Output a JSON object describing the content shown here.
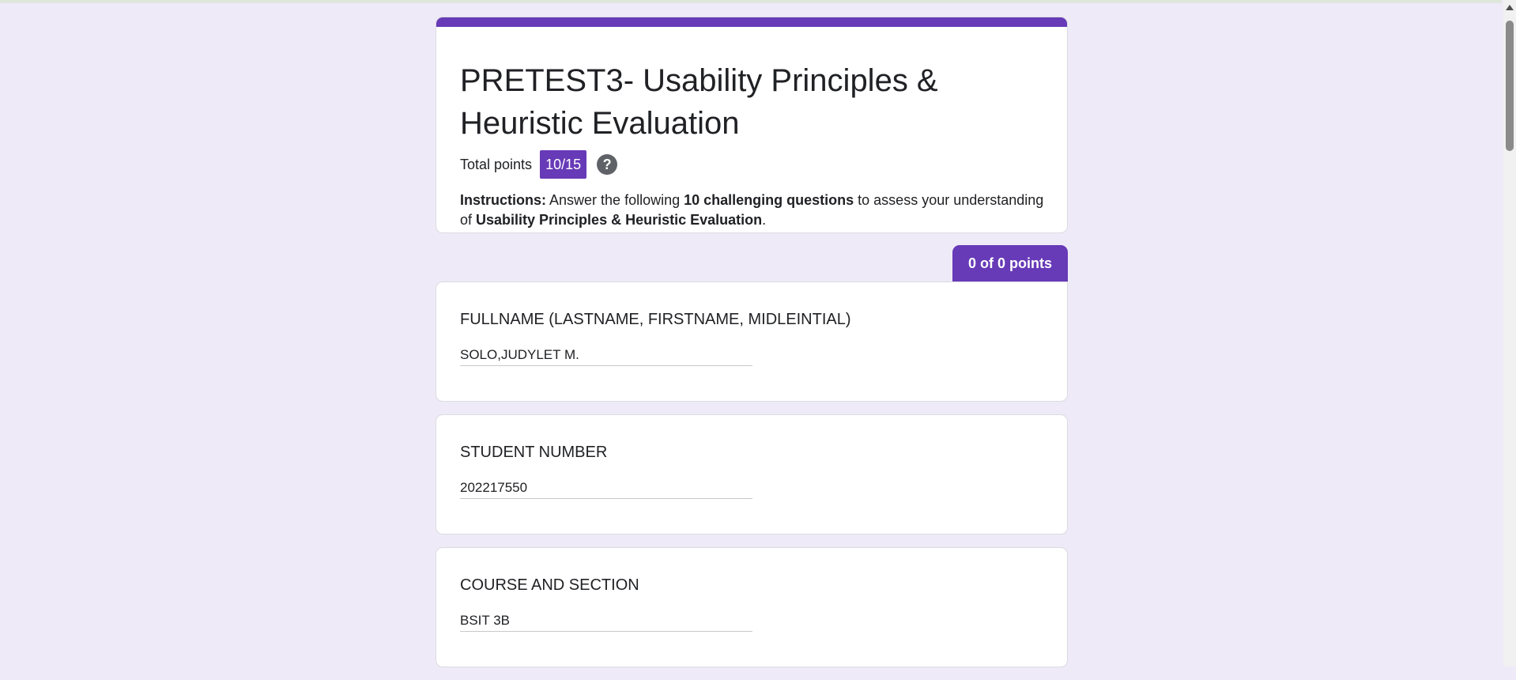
{
  "form": {
    "title": "PRETEST3- Usability Principles & Heuristic Evaluation",
    "total_points_label": "Total points",
    "total_points_value": "10/15",
    "help_glyph": "?",
    "instructions": {
      "label": "Instructions:",
      "part1": " Answer the following ",
      "bold1": "10 challenging questions",
      "part2": " to assess your understanding of ",
      "bold2": "Usability Principles & Heuristic Evaluation",
      "part3": "."
    },
    "accent_color": "#673ab7",
    "background_color": "#efeaf8"
  },
  "section": {
    "points_tab": "0 of 0 points"
  },
  "questions": [
    {
      "title": "FULLNAME (LASTNAME, FIRSTNAME, MIDLEINTIAL)",
      "answer": "SOLO,JUDYLET M."
    },
    {
      "title": "STUDENT NUMBER",
      "answer": "202217550"
    },
    {
      "title": "COURSE AND SECTION",
      "answer": "BSIT 3B"
    }
  ]
}
